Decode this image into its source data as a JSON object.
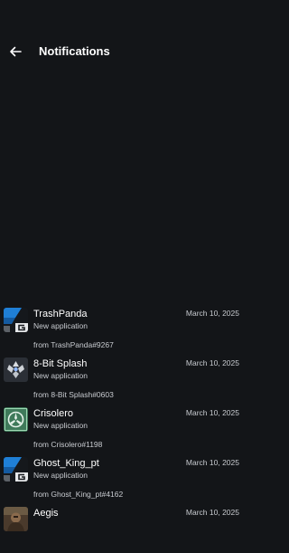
{
  "header": {
    "title": "Notifications"
  },
  "notifications": [
    {
      "name": "TrashPanda",
      "subtitle": "New application",
      "from": "from TrashPanda#9267",
      "date": "March 10, 2025",
      "icon": "trashpanda-avatar-icon"
    },
    {
      "name": "8-Bit Splash",
      "subtitle": "New application",
      "from": "from 8-Bit Splash#0603",
      "date": "March 10, 2025",
      "icon": "destiny-ghost-avatar-icon"
    },
    {
      "name": "Crisolero",
      "subtitle": "New application",
      "from": "from Crisolero#1198",
      "date": "March 10, 2025",
      "icon": "emblem-avatar-icon"
    },
    {
      "name": "Ghost_King_pt",
      "subtitle": "New application",
      "from": "from Ghost_King_pt#4162",
      "date": "March 10, 2025",
      "icon": "trashpanda-avatar-icon"
    },
    {
      "name": "Aegis",
      "date": "March 10, 2025",
      "icon": "character-avatar-icon"
    }
  ]
}
